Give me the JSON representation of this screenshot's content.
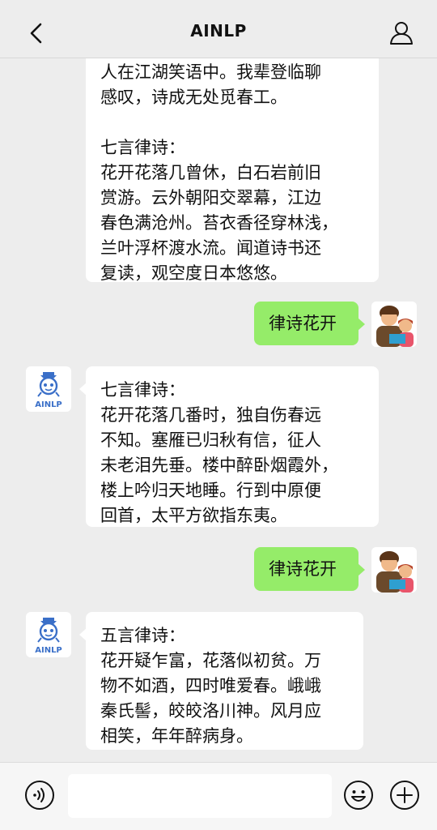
{
  "header": {
    "title": "AINLP"
  },
  "messages": [
    {
      "from": "bot",
      "text": "人在江湖笑语中。我辈登临聊\n感叹，诗成无处觅春工。\n\n七言律诗：\n花开花落几曾休，白石岩前旧\n赏游。云外朝阳交翠幕，江边\n春色满沧州。苔衣香径穿林浅，\n兰叶浮杯渡水流。闻道诗书还\n复读，观空度日本悠悠。"
    },
    {
      "from": "user",
      "text": "律诗花开"
    },
    {
      "from": "bot",
      "text": "七言律诗：\n花开花落几番时，独自伤春远\n不知。塞雁已归秋有信，征人\n未老泪先垂。楼中醉卧烟霞外，\n楼上吟归天地睡。行到中原便\n回首，太平方欲指东夷。"
    },
    {
      "from": "user",
      "text": "律诗花开"
    },
    {
      "from": "bot",
      "text": "五言律诗：\n花开疑乍富，花落似初贫。万\n物不如酒，四时唯爱春。峨峨\n秦氏髻，皎皎洛川神。风月应\n相笑，年年醉病身。"
    }
  ],
  "bot_avatar": {
    "label": "AINLP",
    "icon": "robot-icon"
  },
  "user_avatar": {
    "icon": "parent-child-reading-icon"
  },
  "input": {
    "placeholder": ""
  },
  "colors": {
    "self_bubble": "#95ec69",
    "bot_bubble": "#ffffff",
    "background": "#ededed"
  }
}
